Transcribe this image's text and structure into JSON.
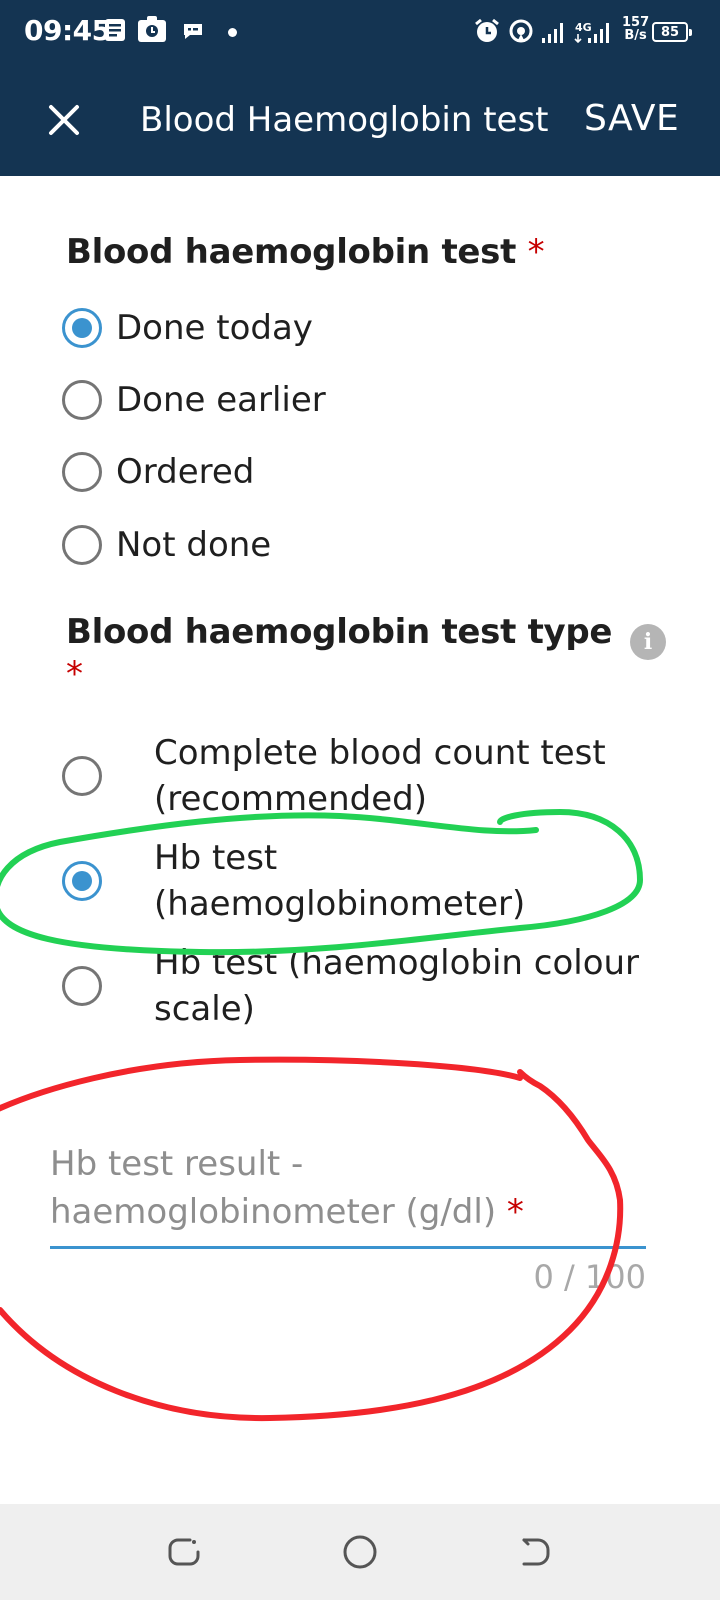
{
  "status_bar": {
    "time": "09:45",
    "net_speed_value": "157",
    "net_speed_unit": "B/s",
    "network_type": "4G",
    "battery": "85"
  },
  "app_bar": {
    "title": "Blood Haemoglobin test",
    "save_label": "SAVE"
  },
  "form": {
    "q1": {
      "label": "Blood haemoglobin test",
      "required_mark": "*",
      "options": [
        {
          "label": "Done today",
          "selected": true
        },
        {
          "label": "Done earlier",
          "selected": false
        },
        {
          "label": "Ordered",
          "selected": false
        },
        {
          "label": "Not done",
          "selected": false
        }
      ]
    },
    "q2": {
      "label": "Blood haemoglobin test type",
      "required_mark": "*",
      "options": [
        {
          "label_line1": "Complete blood count test",
          "label_line2": "(recommended)",
          "selected": false
        },
        {
          "label_line1": "Hb test",
          "label_line2": "(haemoglobinometer)",
          "selected": true
        },
        {
          "label_line1": "Hb test (haemoglobin colour",
          "label_line2": "scale)",
          "selected": false
        }
      ]
    },
    "result_field": {
      "label_line1": "Hb test result -",
      "label_line2": "haemoglobinometer (g/dl)",
      "required_mark": "*",
      "value": "",
      "counter": "0 / 100"
    }
  },
  "icons": {
    "close": "close-icon",
    "info": "info-icon",
    "alarm": "alarm-icon",
    "hotspot": "hotspot-icon",
    "signal": "signal-icon",
    "battery": "battery-icon"
  },
  "colors": {
    "header": "#143452",
    "accent": "#3b93cf",
    "required": "#c60000",
    "annotation_green": "#22d154",
    "annotation_red": "#f2252b"
  }
}
